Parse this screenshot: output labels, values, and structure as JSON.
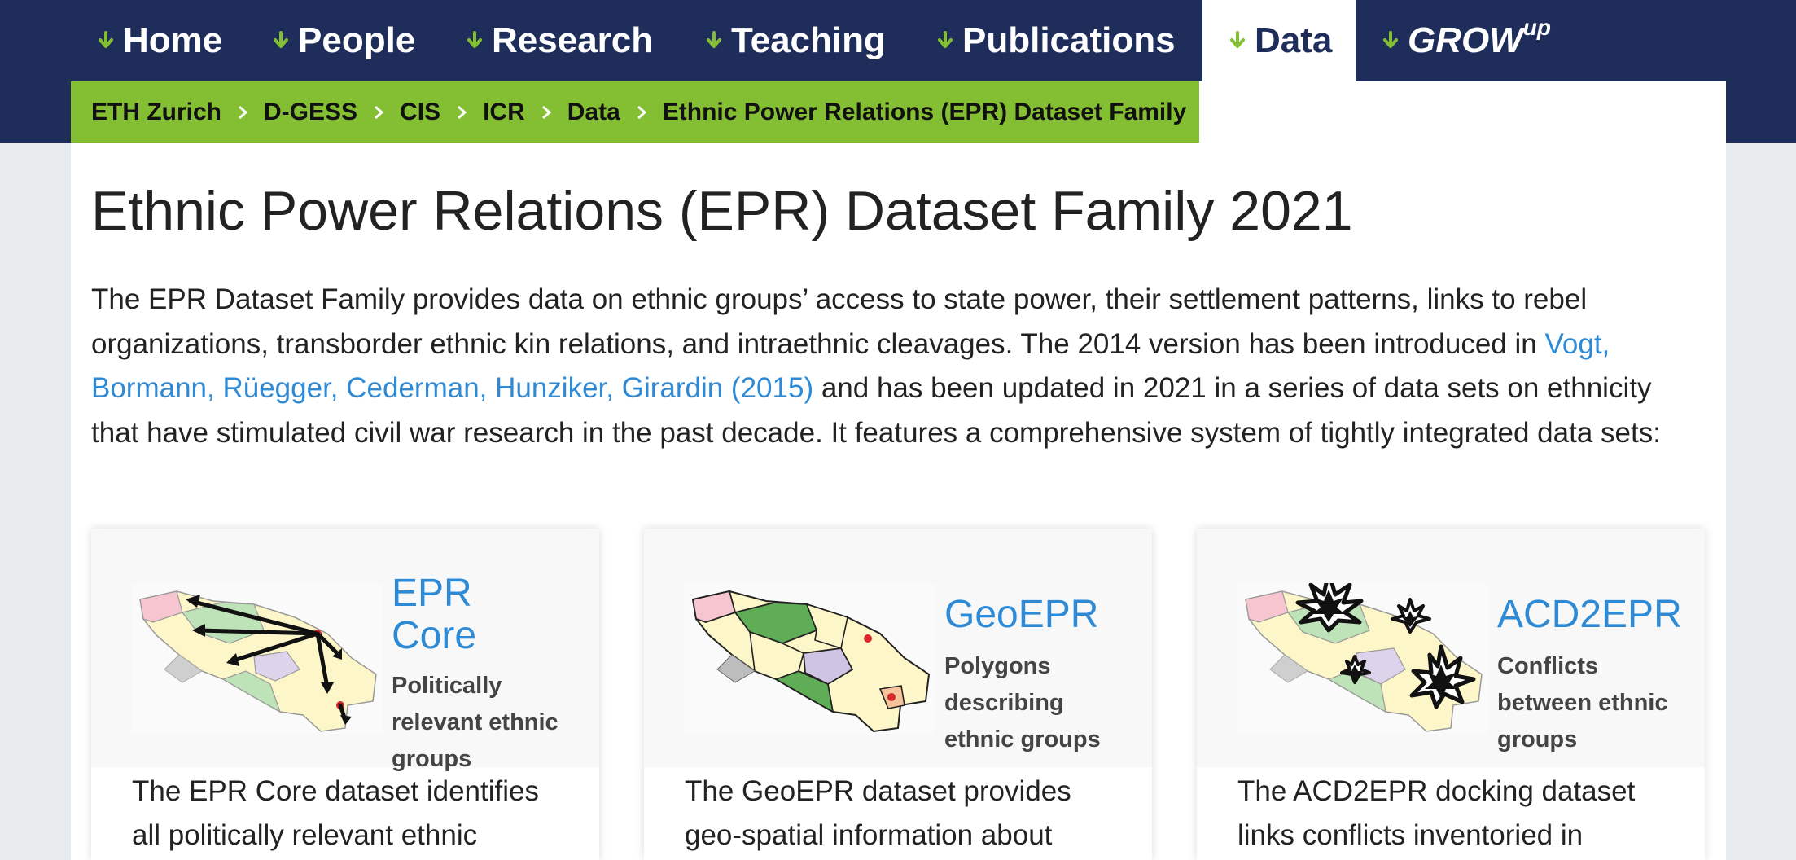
{
  "nav": {
    "items": [
      {
        "label": "Home"
      },
      {
        "label": "People"
      },
      {
        "label": "Research"
      },
      {
        "label": "Teaching"
      },
      {
        "label": "Publications"
      },
      {
        "label": "Data"
      }
    ],
    "grow_label": "GROW",
    "grow_sup": "up",
    "active_item": "Data"
  },
  "breadcrumb": {
    "items": [
      "ETH Zurich",
      "D-GESS",
      "CIS",
      "ICR",
      "Data",
      "Ethnic Power Relations (EPR) Dataset Family"
    ]
  },
  "main": {
    "title": "Ethnic Power Relations (EPR) Dataset Family 2021",
    "intro_part1": "The EPR Dataset Family provides data on ethnic groups’ access to state power, their settlement patterns, links to rebel organizations, transborder ethnic kin relations, and intraethnic cleavages. The 2014 version has been introduced in ",
    "intro_link": "Vogt, Bormann, Rüegger, Cederman, Hunziker, Girardin (2015)",
    "intro_part2": " and has been updated in 2021 in a series of data sets on ethnicity that have stimulated civil war research in the past decade. It features a comprehensive system of tightly integrated data sets:"
  },
  "cards": [
    {
      "title_line1": "EPR",
      "title_line2": "Core",
      "subtitle": "Politically relevant ethnic groups",
      "description": "The EPR Core dataset identifies all politically relevant ethnic"
    },
    {
      "title_line1": "GeoEPR",
      "subtitle": "Polygons describing ethnic groups",
      "description": "The GeoEPR dataset provides geo-spatial information about"
    },
    {
      "title_line1": "ACD2EPR",
      "subtitle": "Conflicts between ethnic groups",
      "description": "The ACD2EPR docking dataset links conflicts inventoried in"
    }
  ],
  "colors": {
    "nav_bg": "#1f2d5a",
    "accent_green": "#84be32",
    "link_blue": "#2f8ad6"
  }
}
